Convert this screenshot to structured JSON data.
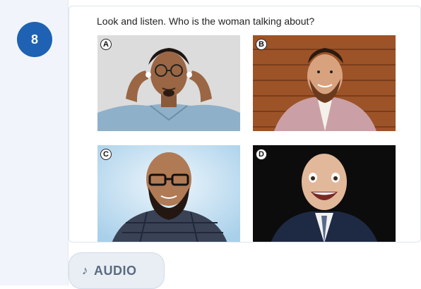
{
  "question": {
    "number": "8",
    "prompt": "Look and listen. Who is the woman talking about?"
  },
  "options": [
    {
      "letter": "A"
    },
    {
      "letter": "B"
    },
    {
      "letter": "C"
    },
    {
      "letter": "D"
    }
  ],
  "audio": {
    "icon": "music-note-icon",
    "glyph": "♪",
    "label": "AUDIO"
  }
}
